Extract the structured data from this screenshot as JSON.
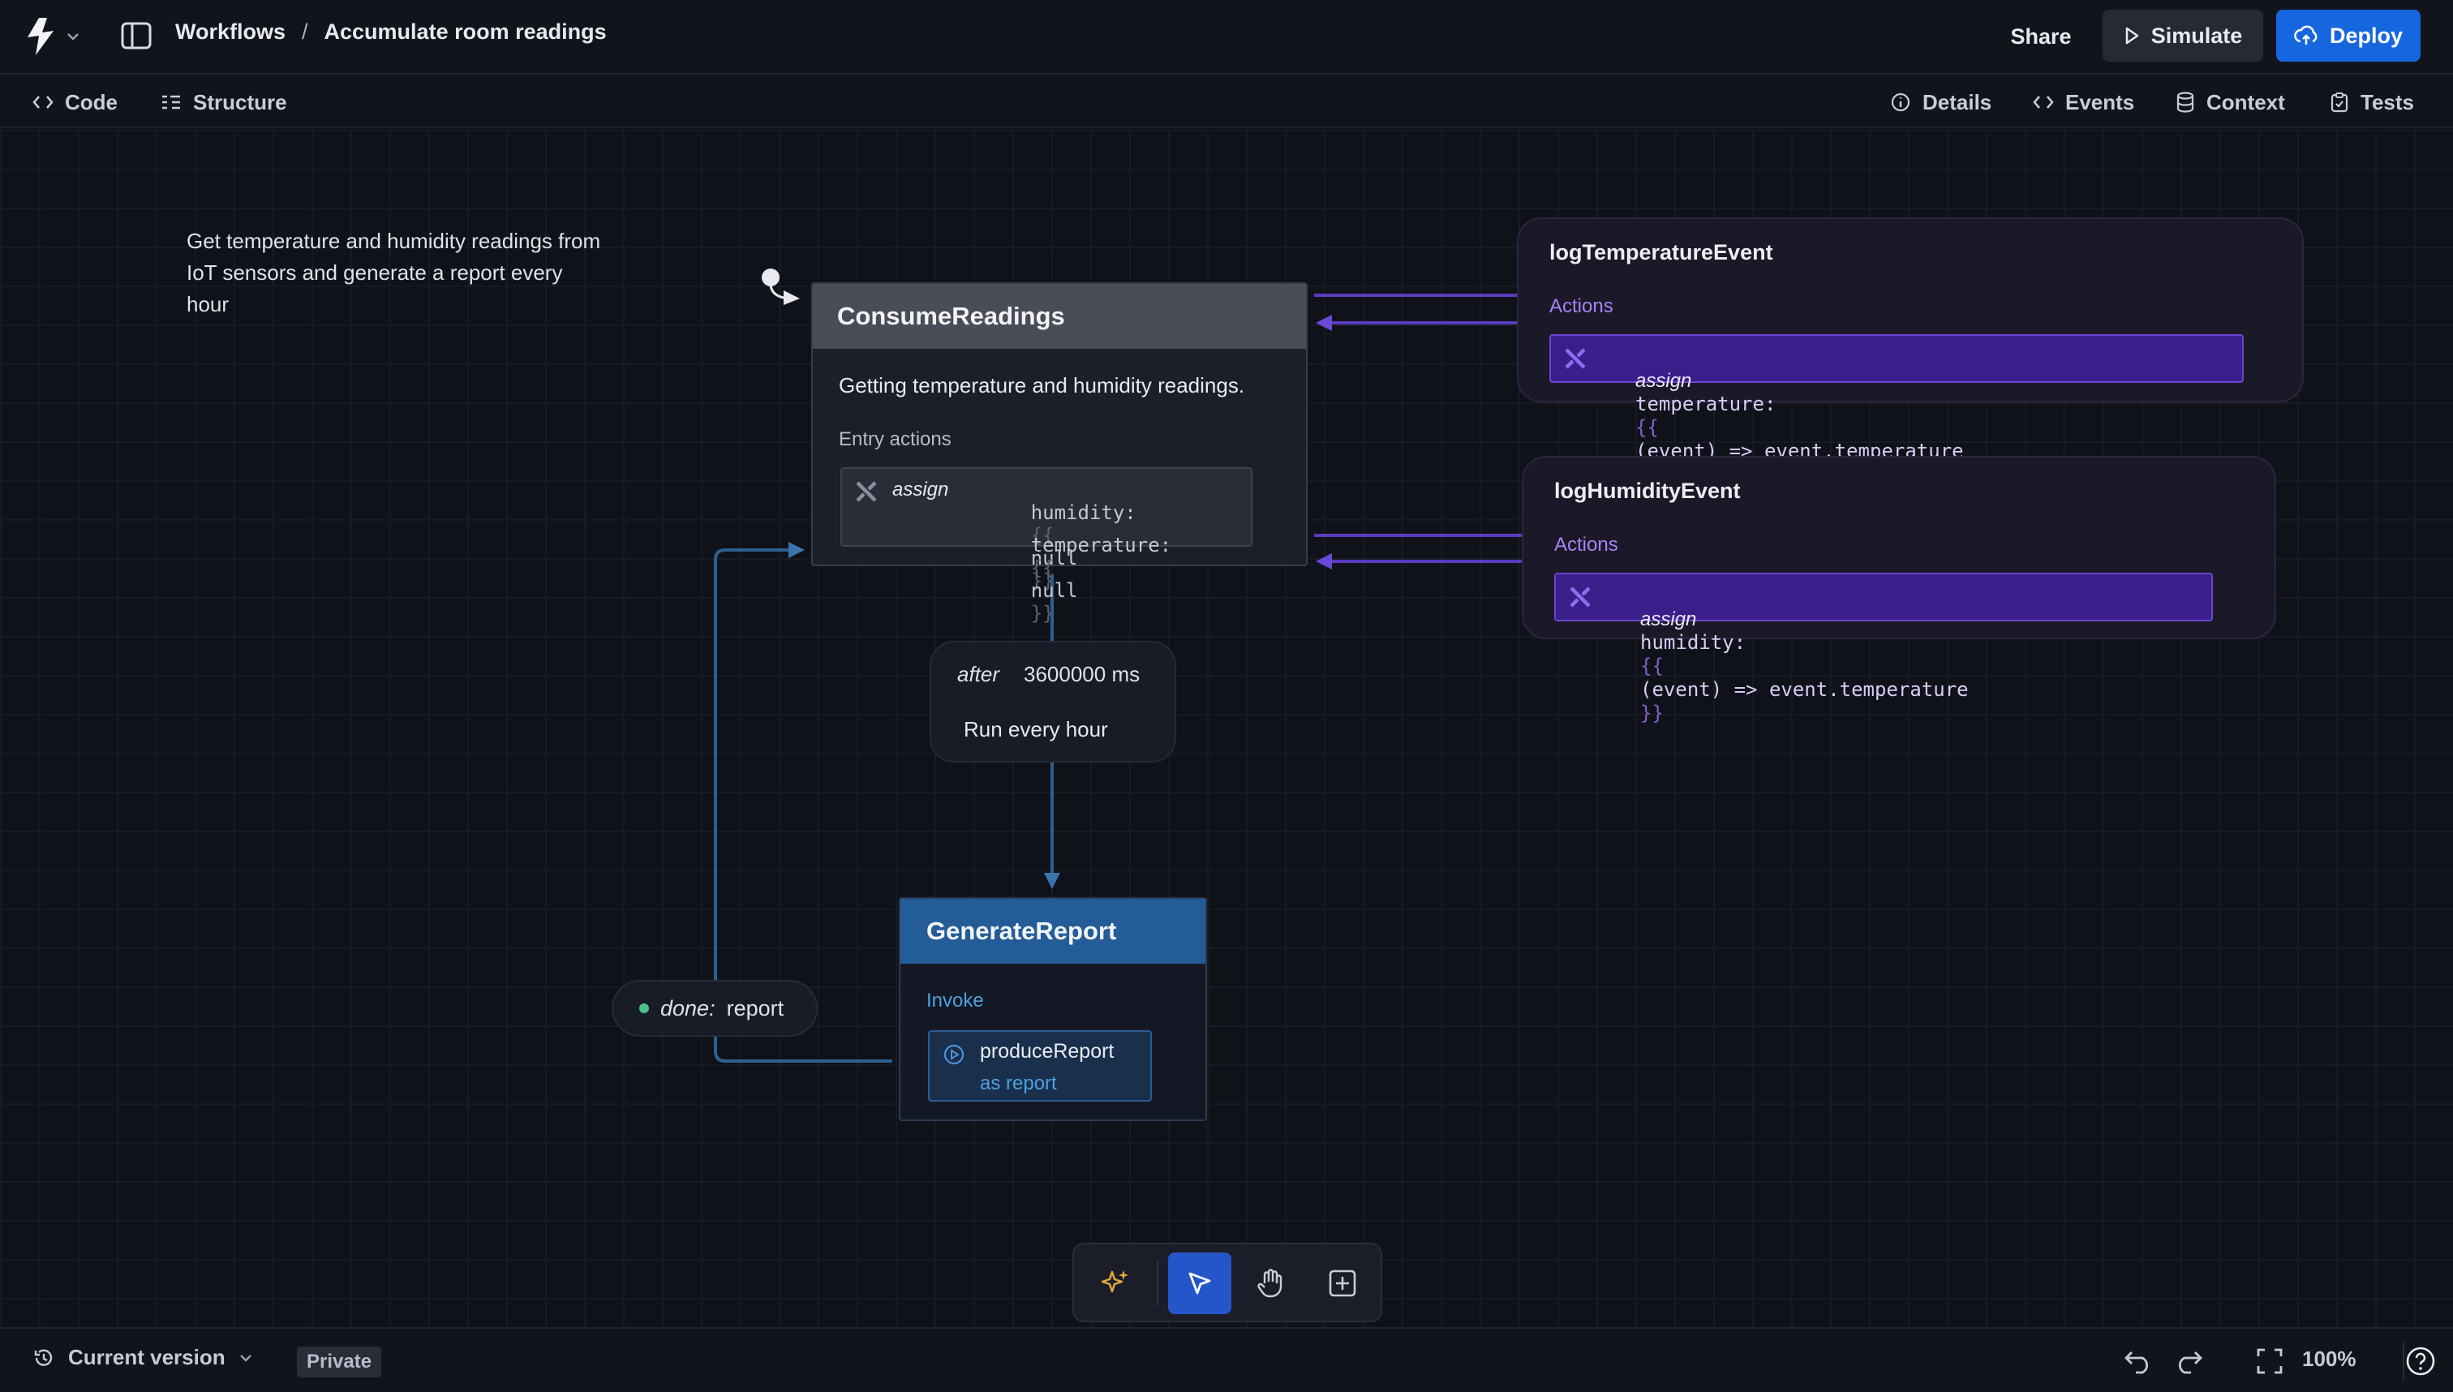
{
  "header": {
    "breadcrumb_root": "Workflows",
    "breadcrumb_sep": "/",
    "breadcrumb_current": "Accumulate room readings",
    "share_label": "Share",
    "simulate_label": "Simulate",
    "deploy_label": "Deploy"
  },
  "subnav": {
    "left_tabs": [
      {
        "label": "Code",
        "icon": "code-icon"
      },
      {
        "label": "Structure",
        "icon": "structure-icon"
      }
    ],
    "right_tabs": [
      {
        "label": "Details",
        "icon": "info-icon"
      },
      {
        "label": "Events",
        "icon": "code-icon"
      },
      {
        "label": "Context",
        "icon": "database-icon"
      },
      {
        "label": "Tests",
        "icon": "clipboard-icon"
      }
    ]
  },
  "canvas": {
    "description": "Get temperature and humidity readings from IoT sensors and generate a report every hour",
    "consume": {
      "title": "ConsumeReadings",
      "description": "Getting temperature and humidity readings.",
      "entry_label": "Entry actions",
      "assign_kw": "assign",
      "line1_key": "humidity:",
      "line1_open": "{{",
      "line1_value": "null",
      "line1_close": "}}",
      "line2_key": "temperature:",
      "line2_open": "{{",
      "line2_value": "null",
      "line2_close": "}}"
    },
    "after": {
      "keyword": "after",
      "delay": "3600000 ms",
      "label": "Run every hour"
    },
    "generate": {
      "title": "GenerateReport",
      "invoke_label": "Invoke",
      "invoke_src": "produceReport",
      "invoke_as": "as report"
    },
    "done": {
      "keyword": "done:",
      "target": "report"
    },
    "events": [
      {
        "title": "logTemperatureEvent",
        "actions_label": "Actions",
        "assign_kw": "assign",
        "key": "temperature:",
        "open": "{{",
        "expr": "(event) => event.temperature",
        "close": "}}"
      },
      {
        "title": "logHumidityEvent",
        "actions_label": "Actions",
        "assign_kw": "assign",
        "key": "humidity:",
        "open": "{{",
        "expr": "(event) => event.temperature",
        "close": "}}"
      }
    ]
  },
  "toolbar": {
    "tools": [
      "sparkles-icon",
      "pointer-icon",
      "hand-icon",
      "add-state-icon"
    ],
    "active": "pointer-icon"
  },
  "statusbar": {
    "version_label": "Current version",
    "visibility": "Private",
    "zoom": "100%"
  },
  "colors": {
    "accent": "#1667df",
    "event": "#6a45d2",
    "transition": "#2f5f8f"
  }
}
